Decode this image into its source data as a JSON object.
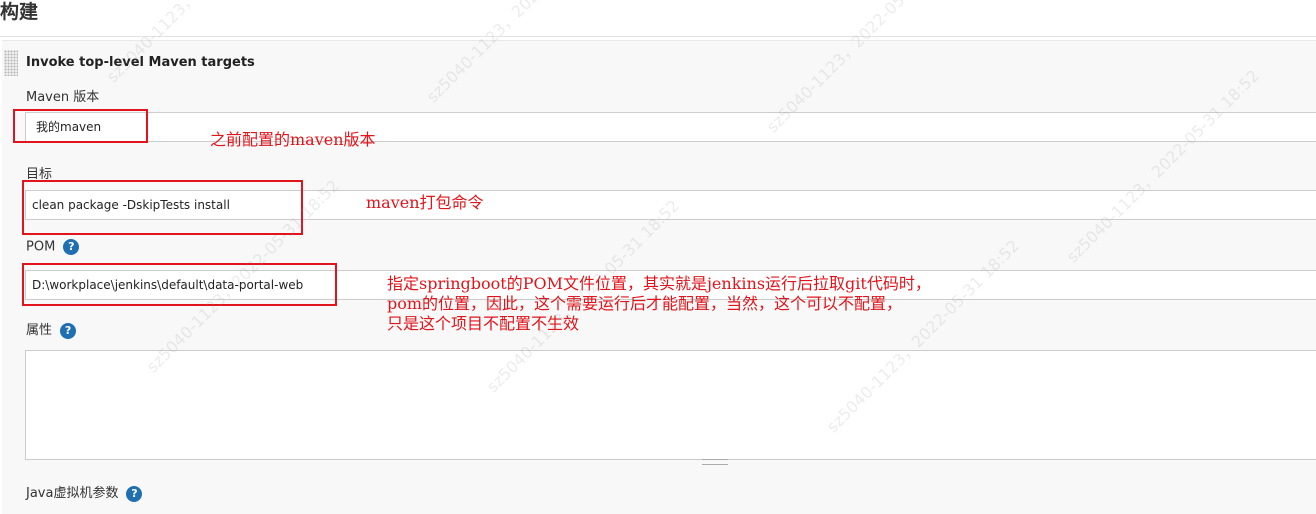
{
  "section": {
    "title": "构建"
  },
  "step": {
    "title": "Invoke top-level Maven targets"
  },
  "maven_version": {
    "label": "Maven 版本",
    "value": "我的maven"
  },
  "goals": {
    "label": "目标",
    "value": "clean package -DskipTests install"
  },
  "pom": {
    "label": "POM",
    "value": "D:\\workplace\\jenkins\\default\\data-portal-web",
    "help": "?"
  },
  "properties": {
    "label": "属性",
    "help": "?",
    "value": ""
  },
  "jvm": {
    "label": "Java虚拟机参数",
    "help": "?"
  },
  "annotations": {
    "maven": "之前配置的maven版本",
    "goals": "maven打包命令",
    "pom_line1": "指定springboot的POM文件位置，其实就是jenkins运行后拉取git代码时，",
    "pom_line2": "pom的位置，因此，这个需要运行后才能配置，当然，这个可以不配置，",
    "pom_line3": "只是这个项目不配置不生效"
  },
  "watermark": "sz5040-1123，2022-05-31 18:52",
  "colors": {
    "annotation": "#e0141a",
    "help": "#1f6fb2",
    "panel": "#f8f8f8"
  }
}
